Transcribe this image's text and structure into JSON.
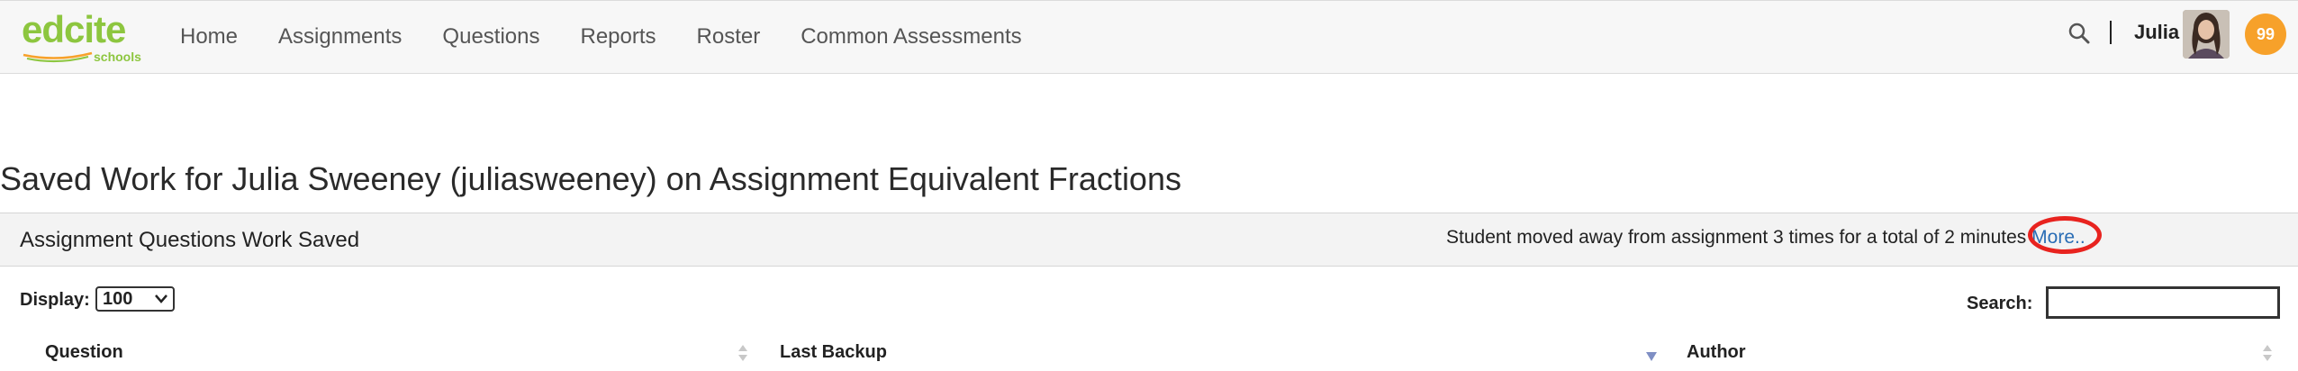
{
  "brand": {
    "logo_text": "edcite",
    "logo_sub": "schools",
    "logo_color": "#8dc63f"
  },
  "nav": {
    "items": [
      {
        "label": "Home"
      },
      {
        "label": "Assignments"
      },
      {
        "label": "Questions"
      },
      {
        "label": "Reports"
      },
      {
        "label": "Roster"
      },
      {
        "label": "Common Assessments"
      }
    ],
    "user_name": "Julia",
    "badge_count": "99",
    "badge_color": "#f7a12a",
    "icons": [
      "search-icon",
      "avatar"
    ]
  },
  "page": {
    "title": "Saved Work for Julia Sweeney (juliasweeney) on Assignment Equivalent Fractions"
  },
  "panel": {
    "title": "Assignment Questions Work Saved",
    "away_text": "Student moved away from assignment 3 times for a total of 2 minutes",
    "more_link": "More.."
  },
  "controls": {
    "display_label": "Display:",
    "display_value": "100",
    "search_label": "Search:",
    "search_value": ""
  },
  "table": {
    "columns": [
      {
        "label": "Question",
        "sort": "unsorted"
      },
      {
        "label": "Last Backup",
        "sort": "descending"
      },
      {
        "label": "Author",
        "sort": "unsorted"
      }
    ]
  },
  "colors": {
    "link": "#2a6db5",
    "highlight": "#e8231f"
  }
}
